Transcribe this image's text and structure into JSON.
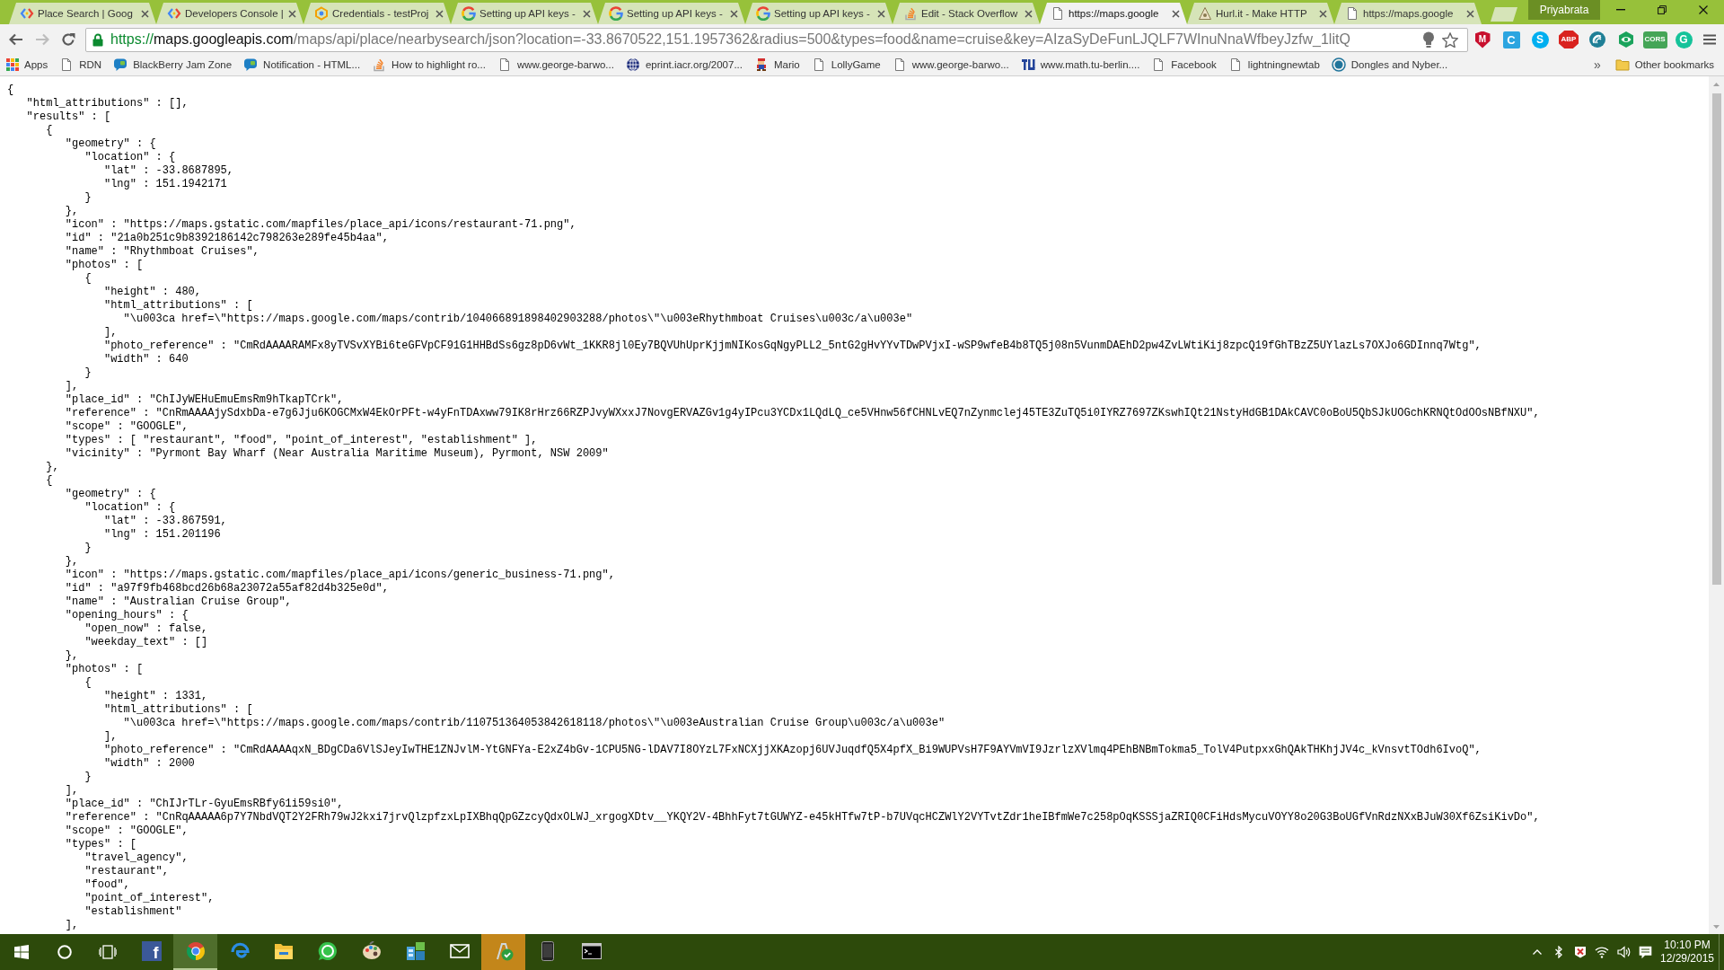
{
  "tabs": [
    {
      "title": "Place Search | Goog",
      "kind": "devconsole",
      "selected": false
    },
    {
      "title": "Developers Console |",
      "kind": "devconsole",
      "selected": false
    },
    {
      "title": "Credentials - testProj",
      "kind": "cloud",
      "selected": false
    },
    {
      "title": "Setting up API keys -",
      "kind": "google",
      "selected": false
    },
    {
      "title": "Setting up API keys -",
      "kind": "google",
      "selected": false
    },
    {
      "title": "Setting up API keys -",
      "kind": "google",
      "selected": false
    },
    {
      "title": "Edit - Stack Overflow",
      "kind": "stack",
      "selected": false
    },
    {
      "title": "https://maps.google",
      "kind": "page",
      "selected": true
    },
    {
      "title": "Hurl.it - Make HTTP",
      "kind": "hurl",
      "selected": false
    },
    {
      "title": "https://maps.google",
      "kind": "page",
      "selected": false
    }
  ],
  "profile": {
    "name": "Priyabrata"
  },
  "toolbar": {
    "back": {
      "disabled": false
    },
    "forward": {
      "disabled": true
    },
    "secure": true,
    "url": {
      "scheme": "https://",
      "host": "maps.googleapis.com",
      "rest": "/maps/api/place/nearbysearch/json?location=-33.8670522,151.1957362&radius=500&types=food&name=cruise&key=AIzaSyDeFunLJQLF7WInuNnaWfbeyJzfw_1litQ"
    },
    "extensions": [
      {
        "kind": "shield",
        "label": "M"
      },
      {
        "kind": "tile",
        "label": "C"
      },
      {
        "kind": "disc",
        "label": "S"
      },
      {
        "kind": "octagon",
        "label": "ABP"
      },
      {
        "kind": "arcs"
      },
      {
        "kind": "eye"
      },
      {
        "kind": "badge",
        "label": "CORS"
      },
      {
        "kind": "ring",
        "label": "G"
      }
    ]
  },
  "bookmarks": {
    "items": [
      {
        "label": "Apps",
        "kind": "apps"
      },
      {
        "label": "RDN",
        "kind": "page"
      },
      {
        "label": "BlackBerry Jam Zone",
        "kind": "blob"
      },
      {
        "label": "Notification - HTML...",
        "kind": "blob"
      },
      {
        "label": "How to highlight ro...",
        "kind": "stack"
      },
      {
        "label": "www.george-barwo...",
        "kind": "page"
      },
      {
        "label": "eprint.iacr.org/2007...",
        "kind": "globe"
      },
      {
        "label": "Mario",
        "kind": "sprite"
      },
      {
        "label": "LollyGame",
        "kind": "page"
      },
      {
        "label": "www.george-barwo...",
        "kind": "page"
      },
      {
        "label": "www.math.tu-berlin....",
        "kind": "blocks"
      },
      {
        "label": "Facebook",
        "kind": "page"
      },
      {
        "label": "lightningnewtab",
        "kind": "page"
      },
      {
        "label": "Dongles and Nyber...",
        "kind": "circle"
      }
    ],
    "overflow": "»",
    "other": {
      "label": "Other bookmarks",
      "kind": "folder"
    }
  },
  "document": {
    "lines": [
      {
        "text": "{",
        "children": [
          {
            "text": "\"html_attributions\" : [],"
          },
          {
            "text": "\"results\" : [",
            "children": [
              {
                "text": "{",
                "children": [
                  {
                    "text": "\"geometry\" : {",
                    "children": [
                      {
                        "text": "\"location\" : {",
                        "children": [
                          {
                            "text": "\"lat\" : -33.8687895,"
                          },
                          {
                            "text": "\"lng\" : 151.1942171"
                          }
                        ]
                      },
                      {
                        "text": "}"
                      }
                    ]
                  },
                  {
                    "text": "},"
                  },
                  {
                    "text": "\"icon\" : \"https://maps.gstatic.com/mapfiles/place_api/icons/restaurant-71.png\","
                  },
                  {
                    "text": "\"id\" : \"21a0b251c9b8392186142c798263e289fe45b4aa\","
                  },
                  {
                    "text": "\"name\" : \"Rhythmboat Cruises\","
                  },
                  {
                    "text": "\"photos\" : [",
                    "children": [
                      {
                        "text": "{",
                        "children": [
                          {
                            "text": "\"height\" : 480,"
                          },
                          {
                            "text": "\"html_attributions\" : [",
                            "children": [
                              {
                                "text": "\"\\u003ca href=\\\"https://maps.google.com/maps/contrib/104066891898402903288/photos\\\"\\u003eRhythmboat Cruises\\u003c/a\\u003e\""
                              }
                            ]
                          },
                          {
                            "text": "],"
                          },
                          {
                            "text": "\"photo_reference\" : \"CmRdAAAARAMFx8yTVSvXYBi6teGFVpCF91G1HHBdSs6gz8pD6vWt_1KKR8jl0Ey7BQVUhUprKjjmNIKosGqNgyPLL2_5ntG2gHvYYvTDwPVjxI-wSP9wfeB4b8TQ5j08n5VunmDAEhD2pw4ZvLWtiKij8zpcQ19fGhTBzZ5UYlazLs7OXJo6GDInnq7Wtg\","
                          },
                          {
                            "text": "\"width\" : 640"
                          }
                        ]
                      },
                      {
                        "text": "}"
                      }
                    ]
                  },
                  {
                    "text": "],"
                  },
                  {
                    "text": "\"place_id\" : \"ChIJyWEHuEmuEmsRm9hTkapTCrk\","
                  },
                  {
                    "text": "\"reference\" : \"CnRmAAAAjySdxbDa-e7g6Jju6KOGCMxW4EkOrPFt-w4yFnTDAxww79IK8rHrz66RZPJvyWXxxJ7NovgERVAZGv1g4yIPcu3YCDx1LQdLQ_ce5VHnw56fCHNLvEQ7nZynmclej45TE3ZuTQ5i0IYRZ7697ZKswhIQt21NstyHdGB1DAkCAVC0oBoU5QbSJkUOGchKRNQtOdOOsNBfNXU\","
                  },
                  {
                    "text": "\"scope\" : \"GOOGLE\","
                  },
                  {
                    "text": "\"types\" : [ \"restaurant\", \"food\", \"point_of_interest\", \"establishment\" ],"
                  },
                  {
                    "text": "\"vicinity\" : \"Pyrmont Bay Wharf (Near Australia Maritime Museum), Pyrmont, NSW 2009\""
                  }
                ]
              },
              {
                "text": "},"
              },
              {
                "text": "{",
                "children": [
                  {
                    "text": "\"geometry\" : {",
                    "children": [
                      {
                        "text": "\"location\" : {",
                        "children": [
                          {
                            "text": "\"lat\" : -33.867591,"
                          },
                          {
                            "text": "\"lng\" : 151.201196"
                          }
                        ]
                      },
                      {
                        "text": "}"
                      }
                    ]
                  },
                  {
                    "text": "},"
                  },
                  {
                    "text": "\"icon\" : \"https://maps.gstatic.com/mapfiles/place_api/icons/generic_business-71.png\","
                  },
                  {
                    "text": "\"id\" : \"a97f9fb468bcd26b68a23072a55af82d4b325e0d\","
                  },
                  {
                    "text": "\"name\" : \"Australian Cruise Group\","
                  },
                  {
                    "text": "\"opening_hours\" : {",
                    "children": [
                      {
                        "text": "\"open_now\" : false,"
                      },
                      {
                        "text": "\"weekday_text\" : []"
                      }
                    ]
                  },
                  {
                    "text": "},"
                  },
                  {
                    "text": "\"photos\" : [",
                    "children": [
                      {
                        "text": "{",
                        "children": [
                          {
                            "text": "\"height\" : 1331,"
                          },
                          {
                            "text": "\"html_attributions\" : [",
                            "children": [
                              {
                                "text": "\"\\u003ca href=\\\"https://maps.google.com/maps/contrib/110751364053842618118/photos\\\"\\u003eAustralian Cruise Group\\u003c/a\\u003e\""
                              }
                            ]
                          },
                          {
                            "text": "],"
                          },
                          {
                            "text": "\"photo_reference\" : \"CmRdAAAAqxN_BDgCDa6VlSJeyIwTHE1ZNJvlM-YtGNFYa-E2xZ4bGv-1CPU5NG-lDAV7I8OYzL7FxNCXjjXKAzopj6UVJuqdfQ5X4pfX_Bi9WUPVsH7F9AYVmVI9JzrlzXVlmq4PEhBNBmTokma5_TolV4PutpxxGhQAkTHKhjJV4c_kVnsvtTOdh6IvoQ\","
                          },
                          {
                            "text": "\"width\" : 2000"
                          }
                        ]
                      },
                      {
                        "text": "}"
                      }
                    ]
                  },
                  {
                    "text": "],"
                  },
                  {
                    "text": "\"place_id\" : \"ChIJrTLr-GyuEmsRBfy61i59si0\","
                  },
                  {
                    "text": "\"reference\" : \"CnRqAAAAA6p7Y7NbdVQT2Y2FRh79wJ2kxi7jrvQlzpfzxLpIXBhqQpGZzcyQdxOLWJ_xrgogXDtv__YKQY2V-4BhhFyt7tGUWYZ-e45kHTfw7tP-b7UVqcHCZWlY2VYTvtZdr1heIBfmWe7c258pOqKSSSjaZRIQ0CFiHdsMycuVOYY8o20G3BoUGfVnRdzNXxBJuW30Xf6ZsiKivDo\","
                  },
                  {
                    "text": "\"scope\" : \"GOOGLE\","
                  },
                  {
                    "text": "\"types\" : [",
                    "children": [
                      {
                        "text": "\"travel_agency\","
                      },
                      {
                        "text": "\"restaurant\","
                      },
                      {
                        "text": "\"food\","
                      },
                      {
                        "text": "\"point_of_interest\","
                      },
                      {
                        "text": "\"establishment\""
                      }
                    ]
                  },
                  {
                    "text": "],"
                  }
                ]
              }
            ]
          }
        ]
      }
    ]
  },
  "taskbar": {
    "apps": [
      {
        "kind": "letter-tile",
        "label": "f",
        "selected": false,
        "alert": false
      },
      {
        "kind": "chrome",
        "selected": true,
        "alert": false
      },
      {
        "kind": "swirl",
        "selected": false,
        "alert": false
      },
      {
        "kind": "folder",
        "selected": false,
        "alert": false
      },
      {
        "kind": "chat",
        "selected": false,
        "alert": false
      },
      {
        "kind": "palette",
        "selected": false,
        "alert": false
      },
      {
        "kind": "blocks",
        "selected": false,
        "alert": false
      },
      {
        "kind": "mail",
        "selected": false,
        "alert": false
      },
      {
        "kind": "check",
        "selected": false,
        "alert": true
      },
      {
        "kind": "phone",
        "selected": false,
        "alert": false
      },
      {
        "kind": "terminal",
        "selected": false,
        "alert": false
      }
    ],
    "clock": {
      "time": "10:10 PM",
      "date": "12/29/2015"
    }
  }
}
